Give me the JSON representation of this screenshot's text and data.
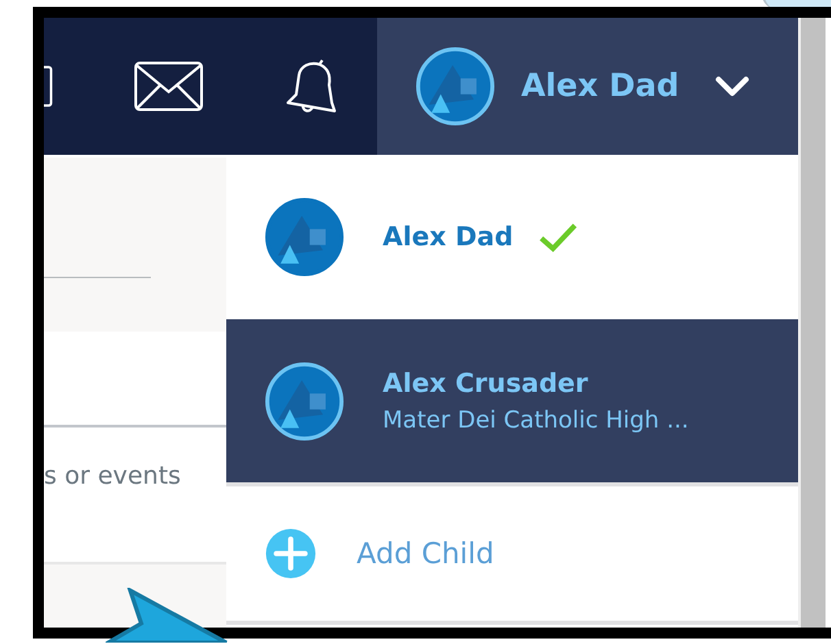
{
  "top_bar": {
    "user_name": "Alex Dad"
  },
  "background": {
    "text_fragment": "s or events"
  },
  "account_menu": {
    "accounts": [
      {
        "name": "Alex Dad",
        "current": true,
        "highlighted": false
      },
      {
        "name": "Alex Crusader",
        "subtitle": "Mater Dei Catholic High ...",
        "current": false,
        "highlighted": true
      }
    ],
    "add_child": {
      "label": "Add Child"
    }
  }
}
